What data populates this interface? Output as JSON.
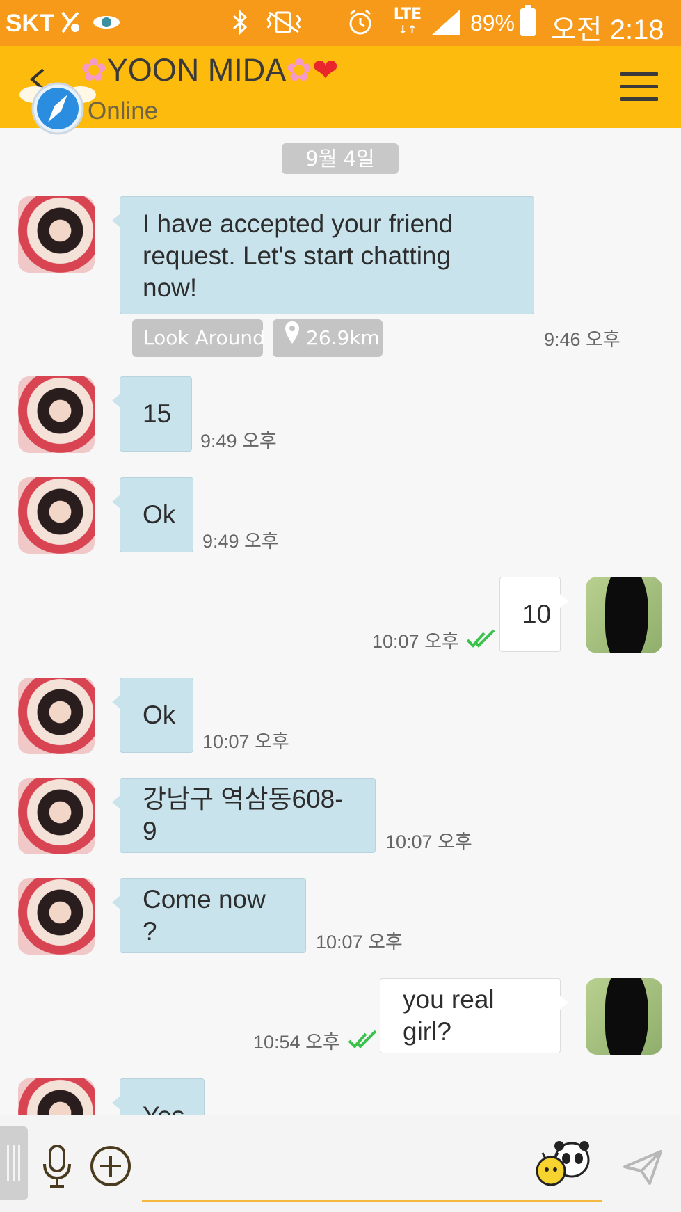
{
  "status_bar": {
    "carrier": "SKT",
    "network": "LTE",
    "battery": "89%",
    "time": "오전 2:18",
    "icons": [
      "notification-icon",
      "camera-app-icon",
      "bluetooth-icon",
      "vibrate-icon",
      "alarm-icon",
      "lte-icon",
      "signal-icon",
      "battery-icon"
    ]
  },
  "header": {
    "title": "YOON MIDA",
    "status": "Online",
    "accent": "#fdbb0d"
  },
  "chat": {
    "date": "9월 4일",
    "messages": [
      {
        "side": "left",
        "text": "I have accepted your friend request. Let's start chatting now!",
        "time": "9:46 오후"
      },
      {
        "side": "left",
        "text": "15",
        "time": "9:49 오후"
      },
      {
        "side": "left",
        "text": "Ok",
        "time": "9:49 오후"
      },
      {
        "side": "right",
        "text": "10",
        "time": "10:07 오후"
      },
      {
        "side": "left",
        "text": "Ok",
        "time": "10:07 오후"
      },
      {
        "side": "left",
        "text": "강남구 역삼동608-9",
        "time": "10:07 오후"
      },
      {
        "side": "left",
        "text": "Come now ?",
        "time": "10:07 오후"
      },
      {
        "side": "right",
        "text": "you real girl?",
        "time": "10:54 오후"
      },
      {
        "side": "left",
        "text": "Yes",
        "time": ""
      }
    ],
    "look_around": "Look Around",
    "distance": "26.9km",
    "bubble_color": "#c9e3ec",
    "read_check_color": "#3cc14c"
  },
  "composer": {
    "icons": [
      "mic-icon",
      "plus-icon",
      "emoji-sticker-icon",
      "send-icon"
    ]
  }
}
